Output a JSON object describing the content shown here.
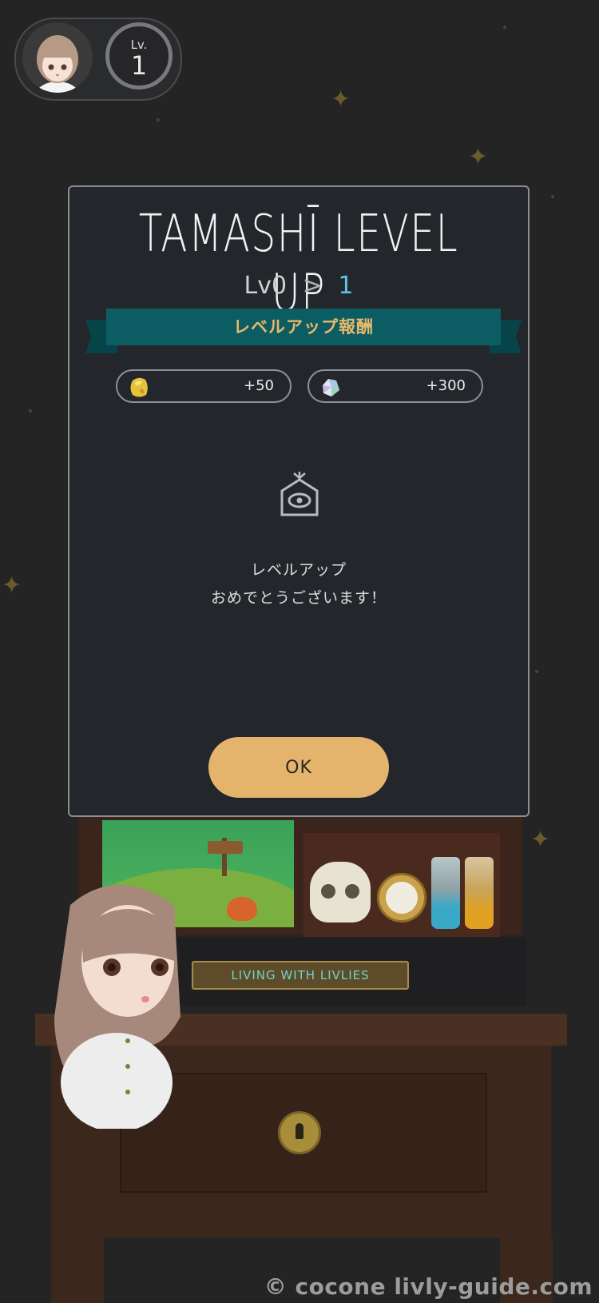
{
  "header": {
    "avatar_icon": "avatar-icon",
    "level_label": "Lv.",
    "level_value": "1"
  },
  "modal": {
    "title": "TAMASHĪ LEVEL UP",
    "level_from": "Lv0",
    "level_arrow": ">",
    "level_to": "1",
    "ribbon_label": "レベルアップ報酬",
    "rewards": [
      {
        "icon": "gold-nugget-icon",
        "amount": "+50"
      },
      {
        "icon": "gem-icon",
        "amount": "+300"
      }
    ],
    "center_icon": "tamashi-house-icon",
    "message_line1": "レベルアップ",
    "message_line2": "おめでとうございます！",
    "ok_label": "OK"
  },
  "scene": {
    "plate_text": "LIVING WITH LIVLIES"
  },
  "watermark": "© cocone livly-guide.com",
  "colors": {
    "background": "#242424",
    "modal_bg": "#23272b",
    "ribbon": "#0c5c63",
    "ribbon_text": "#e7b96a",
    "level_accent": "#5ec4e6",
    "ok_button": "#e5b46c"
  }
}
